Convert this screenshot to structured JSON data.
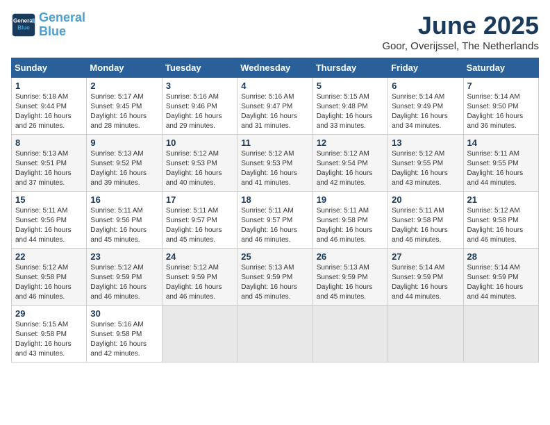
{
  "header": {
    "logo_line1": "General",
    "logo_line2": "Blue",
    "month": "June 2025",
    "location": "Goor, Overijssel, The Netherlands"
  },
  "weekdays": [
    "Sunday",
    "Monday",
    "Tuesday",
    "Wednesday",
    "Thursday",
    "Friday",
    "Saturday"
  ],
  "weeks": [
    [
      {
        "day": "1",
        "info": "Sunrise: 5:18 AM\nSunset: 9:44 PM\nDaylight: 16 hours\nand 26 minutes."
      },
      {
        "day": "2",
        "info": "Sunrise: 5:17 AM\nSunset: 9:45 PM\nDaylight: 16 hours\nand 28 minutes."
      },
      {
        "day": "3",
        "info": "Sunrise: 5:16 AM\nSunset: 9:46 PM\nDaylight: 16 hours\nand 29 minutes."
      },
      {
        "day": "4",
        "info": "Sunrise: 5:16 AM\nSunset: 9:47 PM\nDaylight: 16 hours\nand 31 minutes."
      },
      {
        "day": "5",
        "info": "Sunrise: 5:15 AM\nSunset: 9:48 PM\nDaylight: 16 hours\nand 33 minutes."
      },
      {
        "day": "6",
        "info": "Sunrise: 5:14 AM\nSunset: 9:49 PM\nDaylight: 16 hours\nand 34 minutes."
      },
      {
        "day": "7",
        "info": "Sunrise: 5:14 AM\nSunset: 9:50 PM\nDaylight: 16 hours\nand 36 minutes."
      }
    ],
    [
      {
        "day": "8",
        "info": "Sunrise: 5:13 AM\nSunset: 9:51 PM\nDaylight: 16 hours\nand 37 minutes."
      },
      {
        "day": "9",
        "info": "Sunrise: 5:13 AM\nSunset: 9:52 PM\nDaylight: 16 hours\nand 39 minutes."
      },
      {
        "day": "10",
        "info": "Sunrise: 5:12 AM\nSunset: 9:53 PM\nDaylight: 16 hours\nand 40 minutes."
      },
      {
        "day": "11",
        "info": "Sunrise: 5:12 AM\nSunset: 9:53 PM\nDaylight: 16 hours\nand 41 minutes."
      },
      {
        "day": "12",
        "info": "Sunrise: 5:12 AM\nSunset: 9:54 PM\nDaylight: 16 hours\nand 42 minutes."
      },
      {
        "day": "13",
        "info": "Sunrise: 5:12 AM\nSunset: 9:55 PM\nDaylight: 16 hours\nand 43 minutes."
      },
      {
        "day": "14",
        "info": "Sunrise: 5:11 AM\nSunset: 9:55 PM\nDaylight: 16 hours\nand 44 minutes."
      }
    ],
    [
      {
        "day": "15",
        "info": "Sunrise: 5:11 AM\nSunset: 9:56 PM\nDaylight: 16 hours\nand 44 minutes."
      },
      {
        "day": "16",
        "info": "Sunrise: 5:11 AM\nSunset: 9:56 PM\nDaylight: 16 hours\nand 45 minutes."
      },
      {
        "day": "17",
        "info": "Sunrise: 5:11 AM\nSunset: 9:57 PM\nDaylight: 16 hours\nand 45 minutes."
      },
      {
        "day": "18",
        "info": "Sunrise: 5:11 AM\nSunset: 9:57 PM\nDaylight: 16 hours\nand 46 minutes."
      },
      {
        "day": "19",
        "info": "Sunrise: 5:11 AM\nSunset: 9:58 PM\nDaylight: 16 hours\nand 46 minutes."
      },
      {
        "day": "20",
        "info": "Sunrise: 5:11 AM\nSunset: 9:58 PM\nDaylight: 16 hours\nand 46 minutes."
      },
      {
        "day": "21",
        "info": "Sunrise: 5:12 AM\nSunset: 9:58 PM\nDaylight: 16 hours\nand 46 minutes."
      }
    ],
    [
      {
        "day": "22",
        "info": "Sunrise: 5:12 AM\nSunset: 9:58 PM\nDaylight: 16 hours\nand 46 minutes."
      },
      {
        "day": "23",
        "info": "Sunrise: 5:12 AM\nSunset: 9:59 PM\nDaylight: 16 hours\nand 46 minutes."
      },
      {
        "day": "24",
        "info": "Sunrise: 5:12 AM\nSunset: 9:59 PM\nDaylight: 16 hours\nand 46 minutes."
      },
      {
        "day": "25",
        "info": "Sunrise: 5:13 AM\nSunset: 9:59 PM\nDaylight: 16 hours\nand 45 minutes."
      },
      {
        "day": "26",
        "info": "Sunrise: 5:13 AM\nSunset: 9:59 PM\nDaylight: 16 hours\nand 45 minutes."
      },
      {
        "day": "27",
        "info": "Sunrise: 5:14 AM\nSunset: 9:59 PM\nDaylight: 16 hours\nand 44 minutes."
      },
      {
        "day": "28",
        "info": "Sunrise: 5:14 AM\nSunset: 9:59 PM\nDaylight: 16 hours\nand 44 minutes."
      }
    ],
    [
      {
        "day": "29",
        "info": "Sunrise: 5:15 AM\nSunset: 9:58 PM\nDaylight: 16 hours\nand 43 minutes."
      },
      {
        "day": "30",
        "info": "Sunrise: 5:16 AM\nSunset: 9:58 PM\nDaylight: 16 hours\nand 42 minutes."
      },
      {
        "day": "",
        "info": ""
      },
      {
        "day": "",
        "info": ""
      },
      {
        "day": "",
        "info": ""
      },
      {
        "day": "",
        "info": ""
      },
      {
        "day": "",
        "info": ""
      }
    ]
  ]
}
